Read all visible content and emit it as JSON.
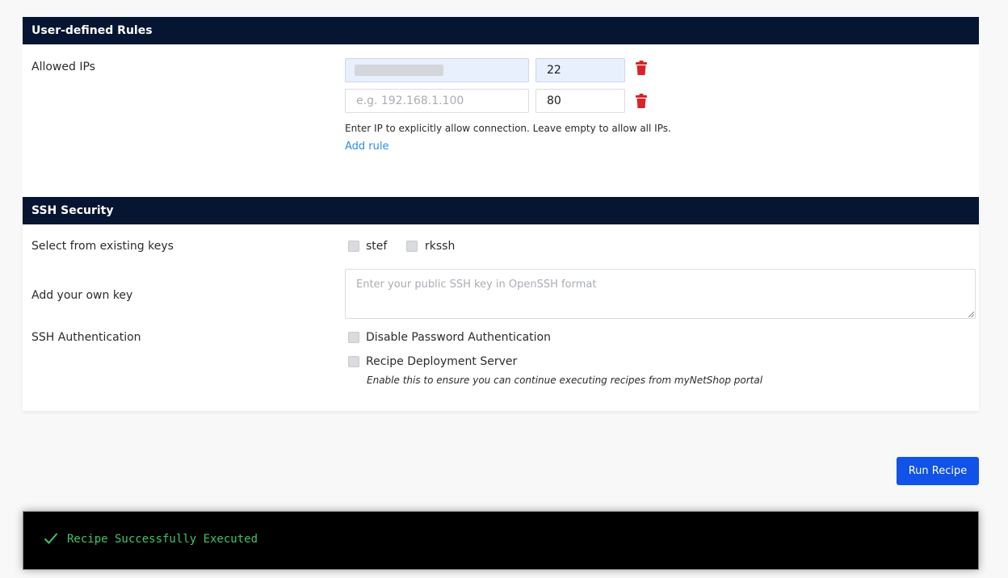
{
  "rules_section": {
    "title": "User-defined Rules",
    "allowed_ips_label": "Allowed IPs",
    "rows": [
      {
        "ip_value": "",
        "ip_placeholder": "",
        "port": "22",
        "redacted": true
      },
      {
        "ip_value": "",
        "ip_placeholder": "e.g. 192.168.1.100",
        "port": "80",
        "redacted": false
      }
    ],
    "help_text": "Enter IP to explicitly allow connection. Leave empty to allow all IPs.",
    "add_rule_label": "Add rule"
  },
  "ssh_section": {
    "title": "SSH Security",
    "existing_keys_label": "Select from existing keys",
    "keys": [
      {
        "name": "stef",
        "checked": false
      },
      {
        "name": "rkssh",
        "checked": false
      }
    ],
    "own_key_label": "Add your own key",
    "own_key_placeholder": "Enter your public SSH key in OpenSSH format",
    "auth_label": "SSH Authentication",
    "disable_password_label": "Disable Password Authentication",
    "recipe_server_label": "Recipe Deployment Server",
    "recipe_server_note": "Enable this to ensure you can continue executing recipes from myNetShop portal"
  },
  "run_button_label": "Run Recipe",
  "terminal": {
    "message": "Recipe Successfully Executed",
    "icon": "check-icon"
  },
  "colors": {
    "header_bg": "#061532",
    "delete_icon": "#d8232a",
    "link": "#2e8ae6",
    "button": "#1152e8",
    "success": "#3ec46d"
  }
}
